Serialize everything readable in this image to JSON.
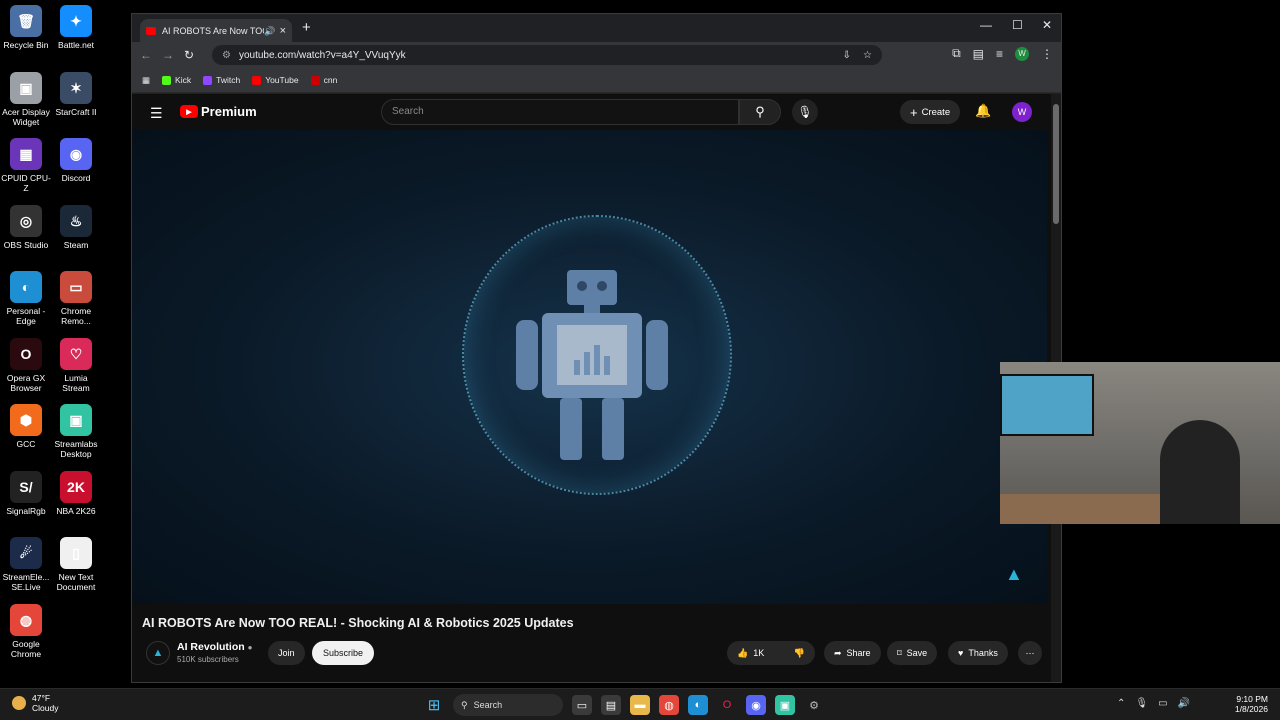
{
  "desktop": {
    "icons": [
      {
        "label": "Recycle Bin",
        "glyph": "🗑",
        "color": "#4a6fa5"
      },
      {
        "label": "Battle.net",
        "glyph": "✦",
        "color": "#148eff"
      },
      {
        "label": "Acer Display Widget",
        "glyph": "▣",
        "color": "#9aa0a6"
      },
      {
        "label": "StarCraft II",
        "glyph": "✶",
        "color": "#3a4b66"
      },
      {
        "label": "CPUID CPU-Z",
        "glyph": "▦",
        "color": "#6a35b8"
      },
      {
        "label": "Discord",
        "glyph": "◉",
        "color": "#5865f2"
      },
      {
        "label": "OBS Studio",
        "glyph": "◎",
        "color": "#333333"
      },
      {
        "label": "Steam",
        "glyph": "♨",
        "color": "#1b2838"
      },
      {
        "label": "Personal - Edge",
        "glyph": "◐",
        "color": "#1f8fd4"
      },
      {
        "label": "Chrome Remo...",
        "glyph": "▭",
        "color": "#c94b3b"
      },
      {
        "label": "Opera GX Browser",
        "glyph": "O",
        "color": "#2a0a0f"
      },
      {
        "label": "Lumia Stream",
        "glyph": "♡",
        "color": "#d92a5a"
      },
      {
        "label": "GCC",
        "glyph": "⬢",
        "color": "#f26b1d"
      },
      {
        "label": "Streamlabs Desktop",
        "glyph": "▣",
        "color": "#31c3a2"
      },
      {
        "label": "SignalRgb",
        "glyph": "S/",
        "color": "#222222"
      },
      {
        "label": "NBA 2K26",
        "glyph": "2K",
        "color": "#c8102e"
      },
      {
        "label": "StreamEle... SE.Live",
        "glyph": "☄",
        "color": "#1d2b4a"
      },
      {
        "label": "New Text Document",
        "glyph": "▯",
        "color": "#f0f0f0"
      },
      {
        "label": "Google Chrome",
        "glyph": "◍",
        "color": "#e5463a"
      }
    ]
  },
  "browser": {
    "tab_title": "AI ROBOTS Are Now TOO R",
    "tab_audio_icon": "speaker-icon",
    "url": "youtube.com/watch?v=a4Y_VVuqYyk",
    "profile_initial": "W",
    "bookmarks": [
      {
        "label": "Kick",
        "color": "#53fc18"
      },
      {
        "label": "Twitch",
        "color": "#9146ff"
      },
      {
        "label": "YouTube",
        "color": "#ff0000"
      },
      {
        "label": "cnn",
        "color": "#cc0000"
      }
    ]
  },
  "youtube": {
    "logo_text": "Premium",
    "search_placeholder": "Search",
    "create_label": "Create",
    "user_initial": "W",
    "video_title": "AI ROBOTS Are Now TOO REAL! - Shocking AI & Robotics 2025 Updates",
    "channel_name": "AI Revolution",
    "subscribers": "510K subscribers",
    "join_label": "Join",
    "subscribe_label": "Subscribe",
    "likes": "1K",
    "share_label": "Share",
    "save_label": "Save",
    "thanks_label": "Thanks"
  },
  "taskbar": {
    "temperature": "47°F",
    "condition": "Cloudy",
    "search_label": "Search",
    "time": "9:10 PM",
    "date": "1/8/2026"
  },
  "colors": {
    "accent_red": "#ff0000",
    "chrome_dark": "#202124",
    "yt_bg": "#0f0f0f"
  }
}
